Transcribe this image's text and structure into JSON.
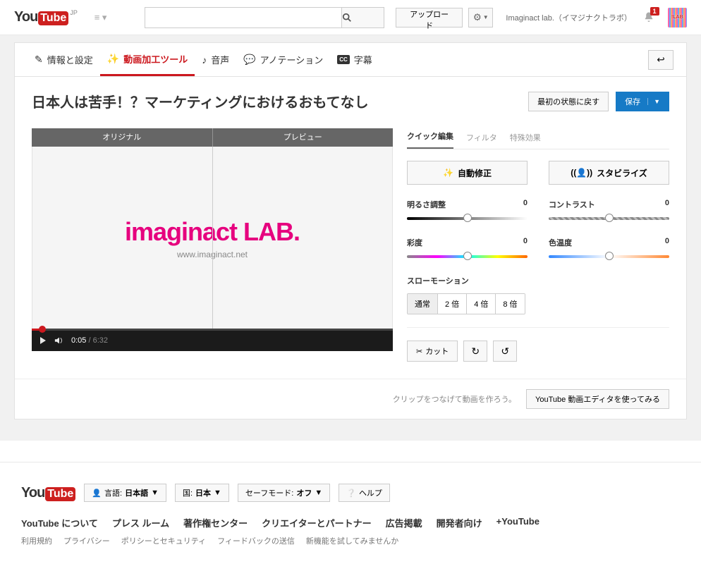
{
  "header": {
    "region": "JP",
    "upload": "アップロード",
    "account": "Imaginact lab.（イマジナクトラボ）",
    "notifications": "1",
    "avatar_text": "!LAB"
  },
  "tabs": {
    "info": "情報と設定",
    "enhance": "動画加工ツール",
    "audio": "音声",
    "annotations": "アノテーション",
    "captions": "字幕"
  },
  "video": {
    "title": "日本人は苦手！？マーケティングにおけるおもてなし",
    "revert": "最初の状態に戻す",
    "save": "保存",
    "original_label": "オリジナル",
    "preview_label": "プレビュー",
    "logo_text": "imaginact LAB.",
    "logo_url": "www.imaginact.net",
    "current_time": "0:05",
    "duration": "6:32"
  },
  "edit": {
    "tabs": {
      "quick": "クイック編集",
      "filters": "フィルタ",
      "effects": "特殊効果"
    },
    "autofix": "自動修正",
    "stabilize": "スタビライズ",
    "brightness": {
      "label": "明るさ調整",
      "value": "0"
    },
    "contrast": {
      "label": "コントラスト",
      "value": "0"
    },
    "saturation": {
      "label": "彩度",
      "value": "0"
    },
    "temperature": {
      "label": "色温度",
      "value": "0"
    },
    "slowmo": {
      "label": "スローモーション",
      "options": [
        "通常",
        "2 倍",
        "4 倍",
        "8 倍"
      ]
    },
    "cut": "カット"
  },
  "editor_cta": {
    "tip": "クリップをつなげて動画を作ろう。",
    "button": "YouTube 動画エディタを使ってみる"
  },
  "footer": {
    "lang_label": "言語:",
    "lang_value": "日本語",
    "country_label": "国:",
    "country_value": "日本",
    "safe_label": "セーフモード:",
    "safe_value": "オフ",
    "help": "ヘルプ",
    "links1": [
      "YouTube について",
      "プレス ルーム",
      "著作権センター",
      "クリエイターとパートナー",
      "広告掲載",
      "開発者向け",
      "+YouTube"
    ],
    "links2": [
      "利用規約",
      "プライバシー",
      "ポリシーとセキュリティ",
      "フィードバックの送信",
      "新機能を試してみませんか"
    ]
  }
}
